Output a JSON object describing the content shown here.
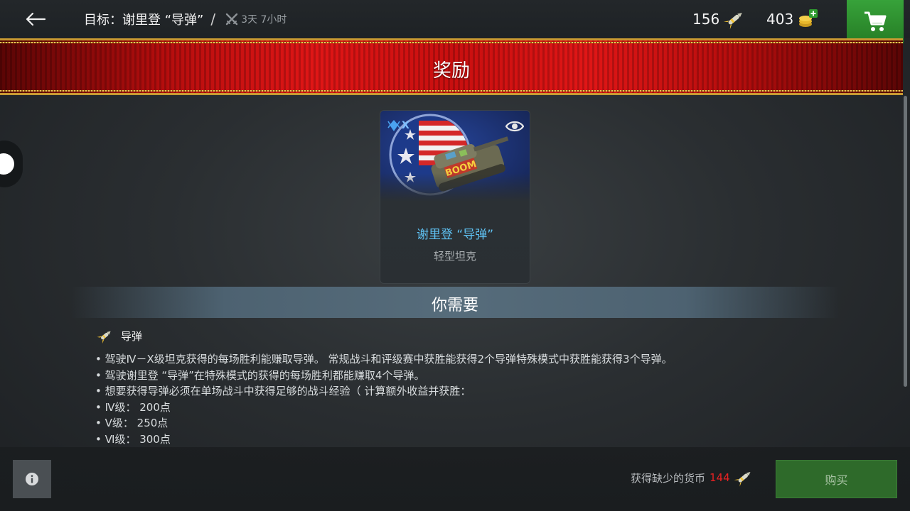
{
  "topbar": {
    "goal_label": "目标：谢里登 “导弹”",
    "separator": "/",
    "timer": "3天 7小时",
    "missiles_count": "156",
    "gold_count": "403",
    "icons": {
      "back": "arrow-left-icon",
      "timer": "crossed-swords-icon",
      "missiles": "missile-icon",
      "gold": "gold-coins-plus-icon",
      "shop": "shopping-cart-icon"
    }
  },
  "banner": {
    "title": "奖励"
  },
  "reward": {
    "tier": "X",
    "name": "谢里登 “导弹”",
    "type": "轻型坦克",
    "icons": {
      "tier": "tier-diamond-icon",
      "preview": "eye-icon",
      "art": "tank-art-icon"
    }
  },
  "requirements": {
    "title": "你需要",
    "item_label": "导弹",
    "lines": [
      "• 驾驶Ⅳ－Ⅹ级坦克获得的每场胜利能赚取导弹。 常规战斗和评级赛中获胜能获得2个导弹特殊模式中获胜能获得3个导弹。",
      "• 驾驶谢里登 “导弹”在特殊模式的获得的每场胜利都能赚取4个导弹。",
      "• 想要获得导弹必须在单场战斗中获得足够的战斗经验（ 计算额外收益并获胜：",
      "• Ⅳ级：  200点",
      "• Ⅴ级：  250点",
      "• Ⅵ级：  300点"
    ]
  },
  "footer": {
    "missing_label": "获得缺少的货币",
    "missing_amount": "144",
    "buy_label": "购买",
    "icons": {
      "info": "info-icon",
      "missile": "missile-icon"
    }
  },
  "colors": {
    "banner_red": "#e01616",
    "banner_gold": "#c99a32",
    "shop_green": "#37a23a",
    "name_blue": "#5fc3f5",
    "missing_red": "#e62222",
    "buy_green": "#2e6a2a"
  }
}
